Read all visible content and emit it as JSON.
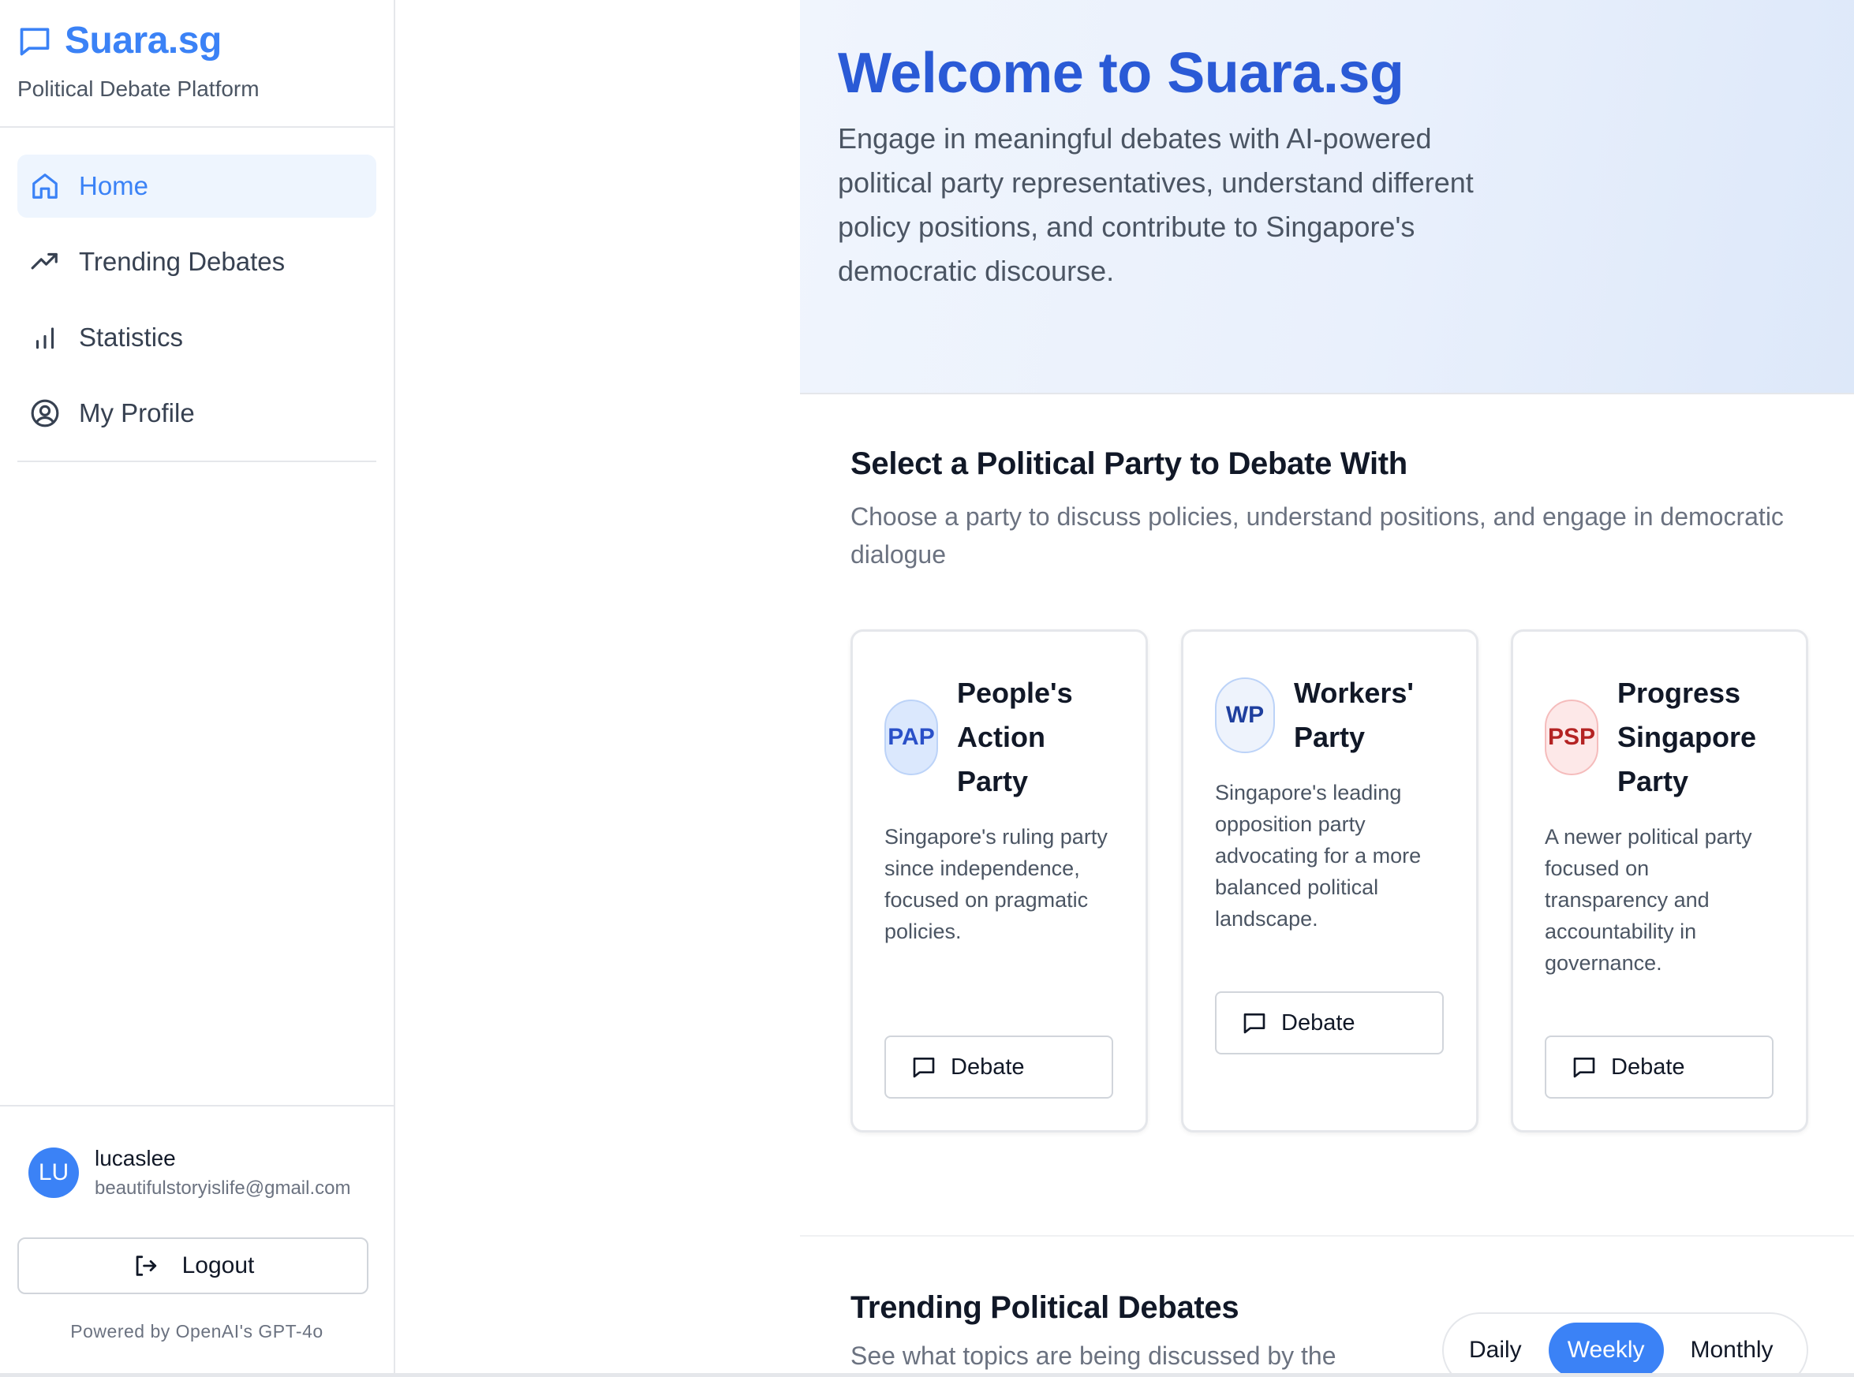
{
  "sidebar": {
    "brand": {
      "name": "Suara.sg",
      "subtitle": "Political Debate Platform"
    },
    "items": [
      {
        "label": "Home",
        "icon": "home-icon",
        "active": true
      },
      {
        "label": "Trending Debates",
        "icon": "trending-up-icon",
        "active": false
      },
      {
        "label": "Statistics",
        "icon": "bar-chart-icon",
        "active": false
      },
      {
        "label": "My Profile",
        "icon": "user-circle-icon",
        "active": false
      }
    ],
    "user": {
      "initials": "LU",
      "name": "lucaslee",
      "email": "beautifulstoryislife@gmail.com"
    },
    "logout_label": "Logout",
    "powered_by": "Powered by OpenAI's GPT-4o"
  },
  "hero": {
    "title": "Welcome to Suara.sg",
    "description": "Engage in meaningful debates with AI-powered political party representatives, understand different policy positions, and contribute to Singapore's democratic discourse."
  },
  "party_section": {
    "title": "Select a Political Party to Debate With",
    "description": "Choose a party to discuss policies, understand positions, and engage in democratic dialogue",
    "parties": [
      {
        "abbr": "PAP",
        "name": "People's Action Party",
        "description": "Singapore's ruling party since independence, focused on pragmatic policies.",
        "button": "Debate",
        "color": "#2a50c8"
      },
      {
        "abbr": "WP",
        "name": "Workers' Party",
        "description": "Singapore's leading opposition party advocating for a more balanced political landscape.",
        "button": "Debate",
        "color": "#1f3f9e"
      },
      {
        "abbr": "PSP",
        "name": "Progress Singapore Party",
        "description": "A newer political party focused on transparency and accountability in governance.",
        "button": "Debate",
        "color": "#b42323"
      }
    ]
  },
  "trending": {
    "title": "Trending Political Debates",
    "description": "See what topics are being discussed by the",
    "periods": [
      "Daily",
      "Weekly",
      "Monthly"
    ],
    "selected_period": "Weekly"
  },
  "colors": {
    "accent": "#3b82f6",
    "hero_title": "#2a5ad6"
  }
}
